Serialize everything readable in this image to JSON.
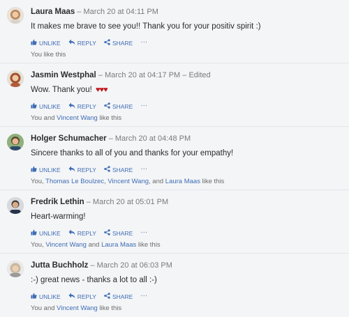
{
  "actions": {
    "unlike": "UNLIKE",
    "reply": "REPLY",
    "share": "SHARE",
    "more": "···"
  },
  "comments": [
    {
      "author": "Laura Maas",
      "meta": "– March 20 at 04:11 PM",
      "text": "It makes me brave to see you!! Thank you for your positiv spirit :)",
      "likes_prefix": "You like this"
    },
    {
      "author": "Jasmin Westphal",
      "meta": "– March 20 at 04:17 PM – Edited",
      "text": "Wow. Thank you!",
      "hearts": "♥♥♥",
      "likes_prefix": "You and ",
      "likes_names": [
        "Vincent Wang"
      ],
      "likes_suffix": " like this"
    },
    {
      "author": "Holger Schumacher",
      "meta": "– March 20 at 04:48 PM",
      "text": "Sincere thanks to all of you and thanks for your empathy!",
      "likes_prefix": "You, ",
      "likes_names": [
        "Thomas Le Boulzec",
        "Vincent Wang",
        "Laura Maas"
      ],
      "likes_sep": [
        ", ",
        ", and "
      ],
      "likes_suffix": " like this"
    },
    {
      "author": "Fredrik Lethin",
      "meta": "– March 20 at 05:01 PM",
      "text": "Heart-warming!",
      "likes_prefix": "You, ",
      "likes_names": [
        "Vincent Wang",
        "Laura Maas"
      ],
      "likes_sep": [
        " and "
      ],
      "likes_suffix": " like this"
    },
    {
      "author": "Jutta Buchholz",
      "meta": "– March 20 at 06:03 PM",
      "text": ":-) great news - thanks a lot to all :-)",
      "likes_prefix": "You and ",
      "likes_names": [
        "Vincent Wang"
      ],
      "likes_suffix": " like this"
    }
  ]
}
